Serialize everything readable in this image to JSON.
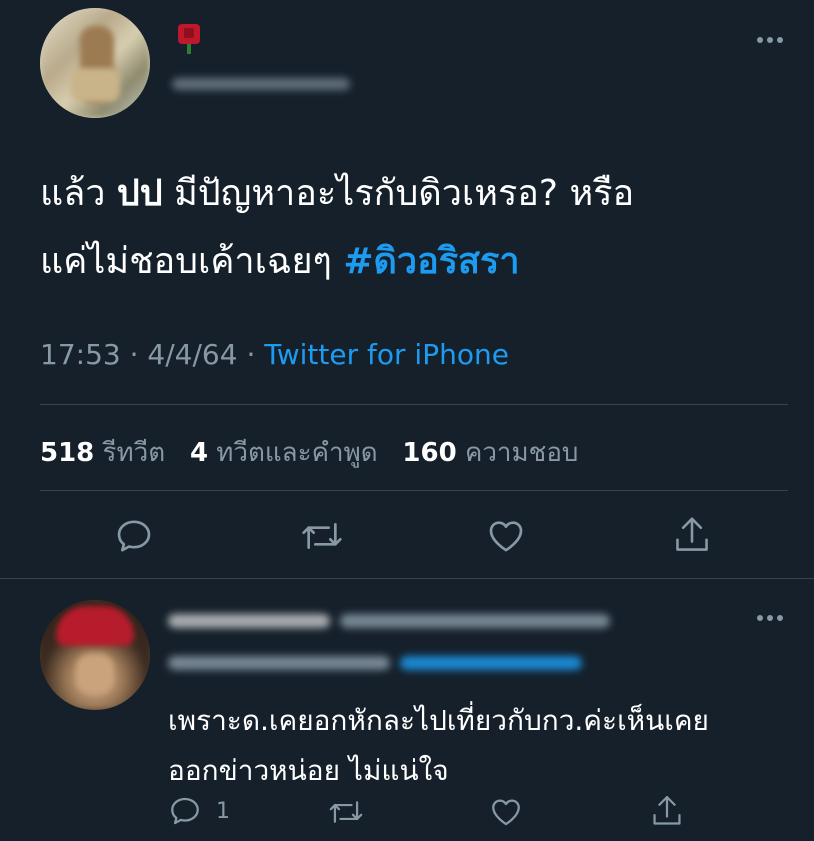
{
  "tweet": {
    "text_part1": "แล้ว ",
    "text_bold": "ปป",
    "text_part2": " มีปัญหาอะไรกับดิวเหรอ? หรือ",
    "text_line2": "แค่ไม่ชอบเค้าเฉยๆ ",
    "hashtag": "#ดิวอริสรา",
    "time": "17:53",
    "sep1": "·",
    "date": "4/4/64",
    "sep2": "·",
    "source": "Twitter for iPhone"
  },
  "stats": {
    "retweets_count": "518",
    "retweets_label": "รีทวีต",
    "quotes_count": "4",
    "quotes_label": "ทวีตและคำพูด",
    "likes_count": "160",
    "likes_label": "ความชอบ"
  },
  "reply": {
    "text_line1": "เพราะด.เคยอกหักละไปเที่ยวกับกว.ค่ะเห็นเคย",
    "text_line2": "ออกข่าวหน่อย ไม่แน่ใจ",
    "reply_count": "1"
  },
  "colors": {
    "background": "#15202b",
    "accent": "#1d9bf0",
    "secondary_text": "#8899a6",
    "divider": "#38444d"
  }
}
